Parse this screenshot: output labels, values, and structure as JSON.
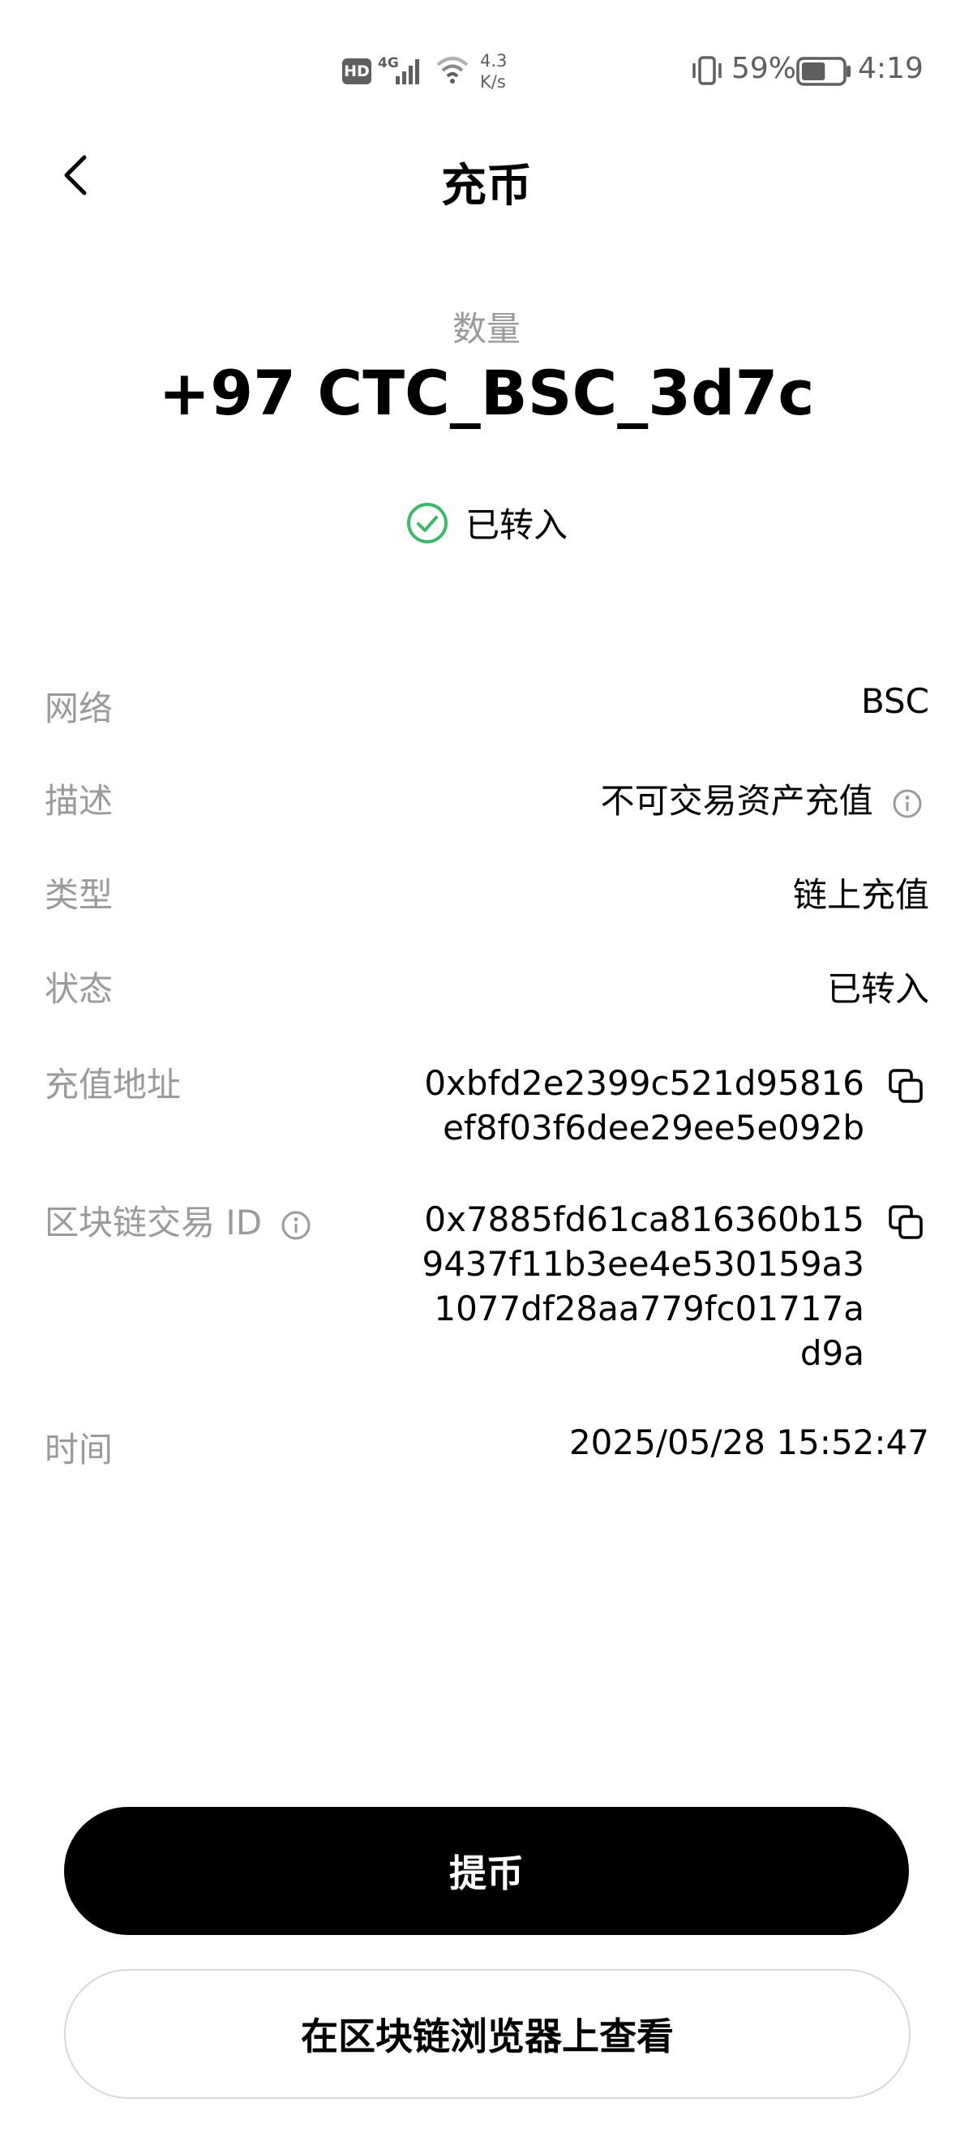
{
  "status_bar": {
    "hd": "HD",
    "network": "4G",
    "speed_value": "4.3",
    "speed_unit": "K/s",
    "battery_percent": "59%",
    "battery_level": 0.59,
    "time": "4:19"
  },
  "nav": {
    "title": "充币"
  },
  "summary": {
    "amount_label": "数量",
    "amount": "+97 CTC_BSC_3d7c",
    "status_text": "已转入",
    "status_color": "#3fb76a"
  },
  "details": {
    "network": {
      "label": "网络",
      "value": "BSC"
    },
    "description": {
      "label": "描述",
      "value": "不可交易资产充值"
    },
    "type": {
      "label": "类型",
      "value": "链上充值"
    },
    "status": {
      "label": "状态",
      "value": "已转入"
    },
    "address": {
      "label": "充值地址",
      "lines": [
        "0xbfd2e2399c521d95816",
        "ef8f03f6dee29ee5e092b"
      ]
    },
    "tx_id": {
      "label": "区块链交易 ID",
      "lines": [
        "0x7885fd61ca816360b15",
        "9437f11b3ee4e530159a3",
        "1077df28aa779fc01717a",
        "d9a"
      ]
    },
    "time": {
      "label": "时间",
      "value": "2025/05/28 15:52:47"
    }
  },
  "buttons": {
    "withdraw": "提币",
    "explorer": "在区块链浏览器上查看"
  },
  "icons": [
    "back-arrow-icon",
    "check-circle-icon",
    "info-icon",
    "copy-icon",
    "signal-icon",
    "wifi-icon",
    "vibrate-icon",
    "battery-icon"
  ]
}
